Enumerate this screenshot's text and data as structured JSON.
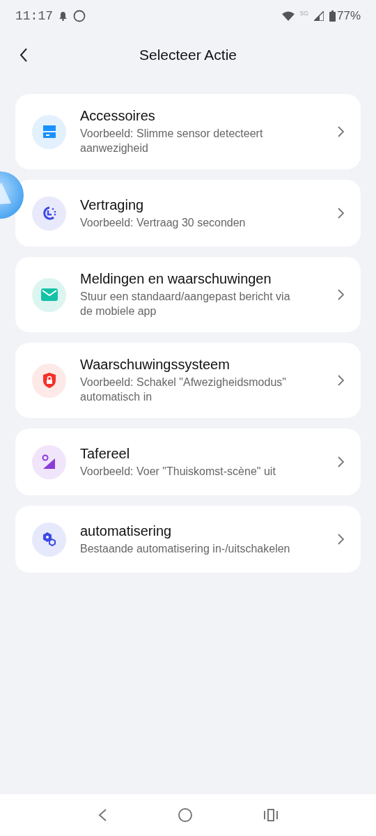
{
  "status_bar": {
    "time": "11:17",
    "network": "5G",
    "battery": "77%"
  },
  "header": {
    "title": "Selecteer Actie"
  },
  "actions": [
    {
      "title": "Accessoires",
      "description": "Voorbeeld: Slimme sensor detecteert aanwezigheid"
    },
    {
      "title": "Vertraging",
      "description": "Voorbeeld: Vertraag 30 seconden"
    },
    {
      "title": "Meldingen en waarschuwingen",
      "description": "Stuur een standaard/aangepast bericht via de mobiele app"
    },
    {
      "title": "Waarschuwingssysteem",
      "description": "Voorbeeld: Schakel \"Afwezigheidsmodus\" automatisch in"
    },
    {
      "title": "Tafereel",
      "description": "Voorbeeld: Voer \"Thuiskomst-scène\" uit"
    },
    {
      "title": "automatisering",
      "description": "Bestaande automatisering in-/uitschakelen"
    }
  ]
}
